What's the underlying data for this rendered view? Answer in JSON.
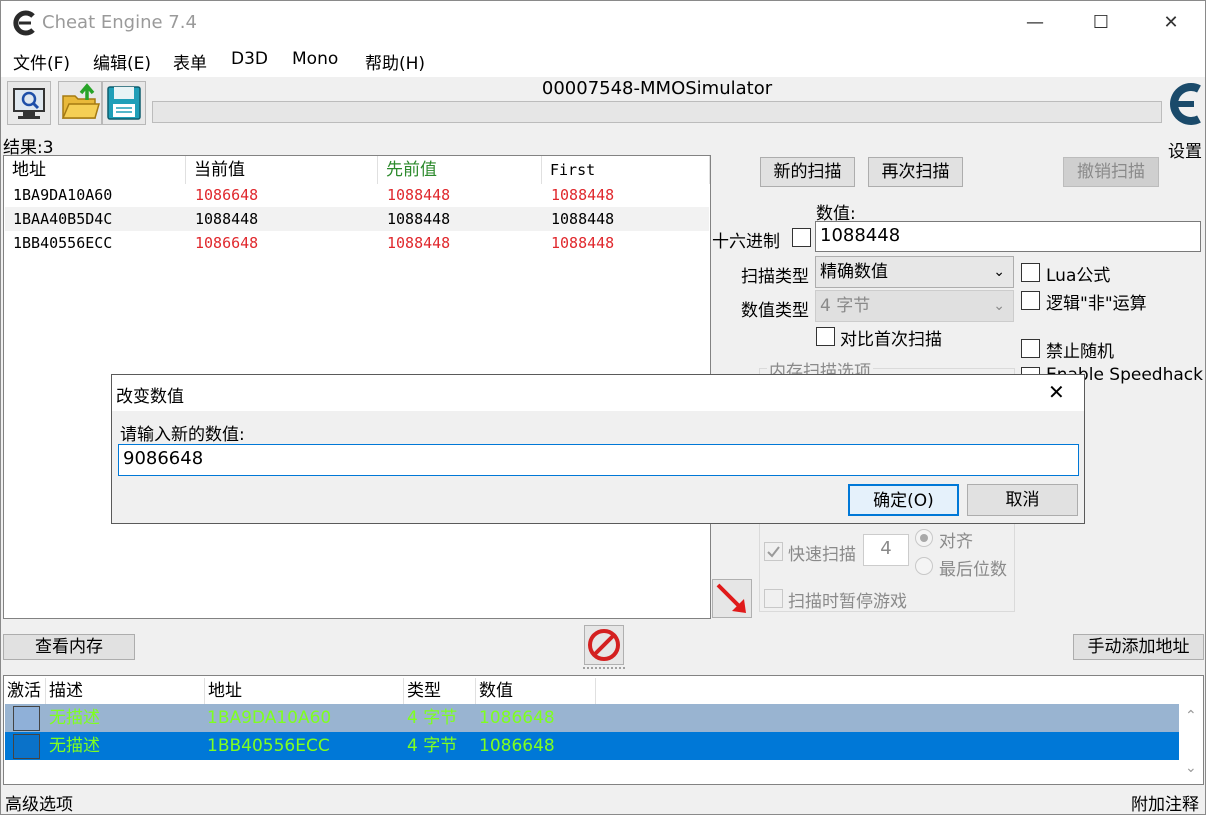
{
  "window": {
    "title": "Cheat Engine 7.4",
    "minimize": "—",
    "maximize": "☐",
    "close": "✕"
  },
  "menu": [
    "文件(F)",
    "编辑(E)",
    "表单",
    "D3D",
    "Mono",
    "帮助(H)"
  ],
  "process_name": "00007548-MMOSimulator",
  "settings_label": "设置",
  "results_label": "结果:3",
  "scan_list": {
    "headers": [
      "地址",
      "当前值",
      "先前值",
      "First"
    ],
    "rows": [
      {
        "address": "1BA9DA10A60",
        "current": "1086648",
        "previous": "1088448",
        "first": "1088448",
        "changed": true
      },
      {
        "address": "1BAA40B5D4C",
        "current": "1088448",
        "previous": "1088448",
        "first": "1088448",
        "changed": false
      },
      {
        "address": "1BB40556ECC",
        "current": "1086648",
        "previous": "1088448",
        "first": "1088448",
        "changed": true
      }
    ]
  },
  "scan": {
    "new_scan": "新的扫描",
    "next_scan": "再次扫描",
    "undo_scan": "撤销扫描",
    "value_label": "数值:",
    "hex_label": "十六进制",
    "value": "1088448",
    "scan_type_label": "扫描类型",
    "scan_type": "精确数值",
    "value_type_label": "数值类型",
    "value_type": "4 字节",
    "compare_first": "对比首次扫描",
    "lua_formula": "Lua公式",
    "logical_not": "逻辑\"非\"运算",
    "disable_random": "禁止随机",
    "enable_speedhack": "Enable Speedhack",
    "memory_options": "内存扫描选项",
    "fast_scan": "快速扫描",
    "fast_scan_value": "4",
    "align": "对齐",
    "last_digits": "最后位数",
    "pause_game": "扫描时暂停游戏"
  },
  "buttons": {
    "view_memory": "查看内存",
    "add_address": "手动添加地址"
  },
  "address_list": {
    "headers": [
      "激活",
      "描述",
      "地址",
      "类型",
      "数值"
    ],
    "rows": [
      {
        "description": "无描述",
        "address": "1BA9DA10A60",
        "type": "4 字节",
        "value": "1086648"
      },
      {
        "description": "无描述",
        "address": "1BB40556ECC",
        "type": "4 字节",
        "value": "1086648"
      }
    ]
  },
  "footer": {
    "advanced": "高级选项",
    "comments": "附加注释"
  },
  "dialog": {
    "title": "改变数值",
    "prompt": "请输入新的数值:",
    "value": "9086648",
    "ok": "确定(O)",
    "cancel": "取消",
    "close": "✕"
  },
  "colors": {
    "changed_value": "#e0282d",
    "previous_header": "#2c8a2c",
    "row_selected": "#0078d7",
    "row_highlight": "#99b4d1",
    "address_text": "#7fff1f"
  }
}
